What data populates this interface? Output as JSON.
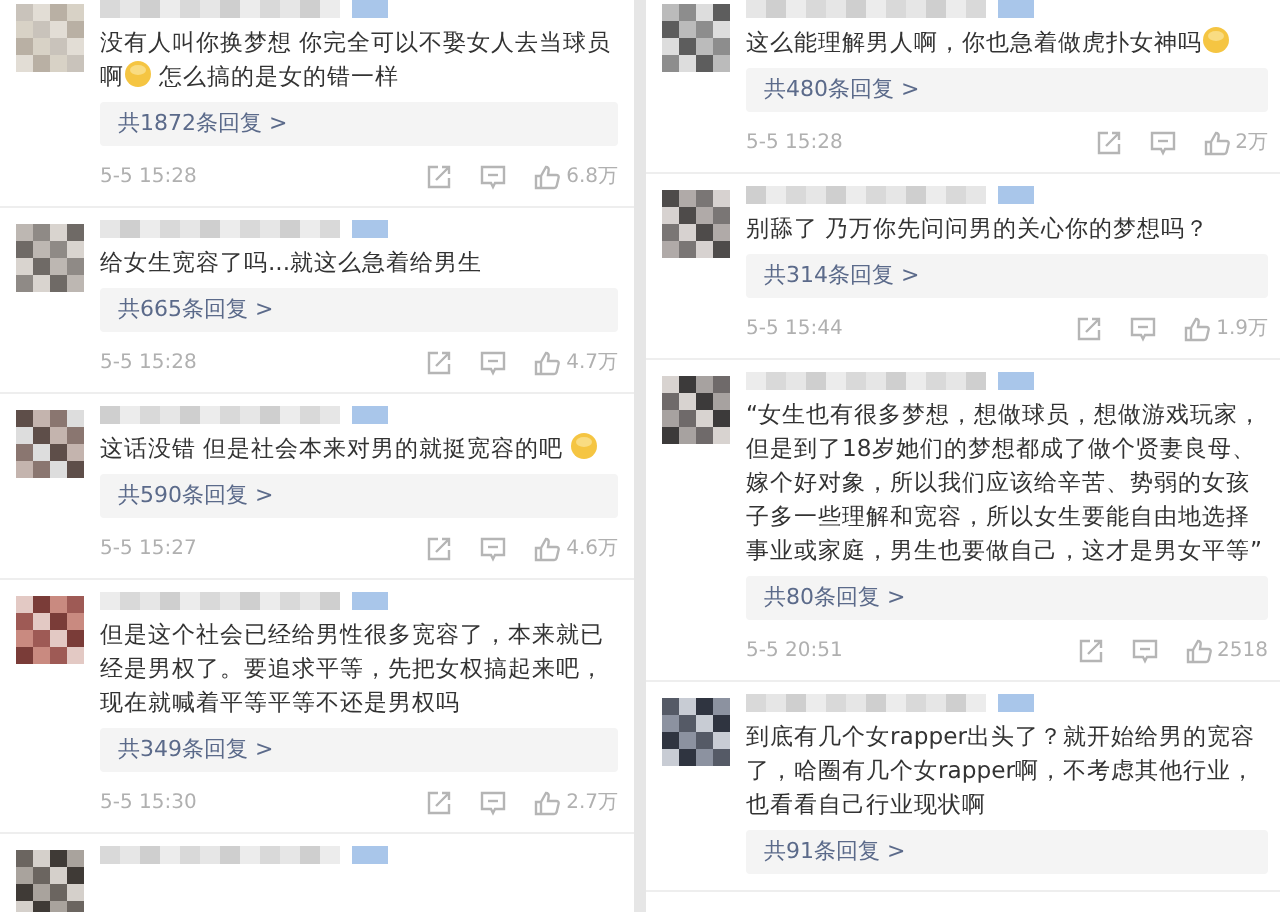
{
  "columns": [
    {
      "comments": [
        {
          "kind": "full",
          "segments": [
            {
              "kind": "line",
              "text": "没有人叫你换梦想 你完全可以不娶女人去当球员"
            },
            {
              "kind": "text",
              "text": "啊"
            },
            {
              "kind": "emoji"
            },
            {
              "kind": "text",
              "text": " 怎么搞的是女的错一样"
            }
          ],
          "replies": "共1872条回复 >",
          "time": "5-5 15:28",
          "likes": "6.8万"
        },
        {
          "kind": "full",
          "segments": [
            {
              "kind": "text",
              "text": "给女生宽容了吗...就这么急着给男生"
            }
          ],
          "replies": "共665条回复 >",
          "time": "5-5 15:28",
          "likes": "4.7万"
        },
        {
          "kind": "full",
          "segments": [
            {
              "kind": "text",
              "text": "这话没错 但是社会本来对男的就挺宽容的吧 "
            },
            {
              "kind": "emoji"
            }
          ],
          "replies": "共590条回复 >",
          "time": "5-5 15:27",
          "likes": "4.6万"
        },
        {
          "kind": "full",
          "segments": [
            {
              "kind": "text",
              "text": "但是这个社会已经给男性很多宽容了，本来就已经是男权了。要追求平等，先把女权搞起来吧，现在就喊着平等平等不还是男权吗"
            }
          ],
          "replies": "共349条回复 >",
          "time": "5-5 15:30",
          "likes": "2.7万"
        },
        {
          "kind": "partial"
        }
      ]
    },
    {
      "comments": [
        {
          "kind": "full",
          "segments": [
            {
              "kind": "text",
              "text": "这么能理解男人啊，你也急着做虎扑女神吗"
            },
            {
              "kind": "emoji"
            }
          ],
          "replies": "共480条回复 >",
          "time": "5-5 15:28",
          "likes": "2万"
        },
        {
          "kind": "full",
          "segments": [
            {
              "kind": "text",
              "text": "别舔了 乃万你先问问男的关心你的梦想吗？"
            }
          ],
          "replies": "共314条回复 >",
          "time": "5-5 15:44",
          "likes": "1.9万"
        },
        {
          "kind": "full",
          "segments": [
            {
              "kind": "text",
              "text": "“女生也有很多梦想，想做球员，想做游戏玩家，但是到了18岁她们的梦想都成了做个贤妻良母、嫁个好对象，所以我们应该给辛苦、势弱的女孩子多一些理解和宽容，所以女生要能自由地选择事业或家庭，男生也要做自己，这才是男女平等”"
            }
          ],
          "replies": "共80条回复 >",
          "time": "5-5 20:51",
          "likes": "2518"
        },
        {
          "kind": "full",
          "segments": [
            {
              "kind": "text",
              "text": "到底有几个女rapper出头了？就开始给男的宽容了，哈圈有几个女rapper啊，不考虑其他行业，也看看自己行业现状啊"
            }
          ],
          "replies": "共91条回复 >"
        }
      ]
    }
  ]
}
